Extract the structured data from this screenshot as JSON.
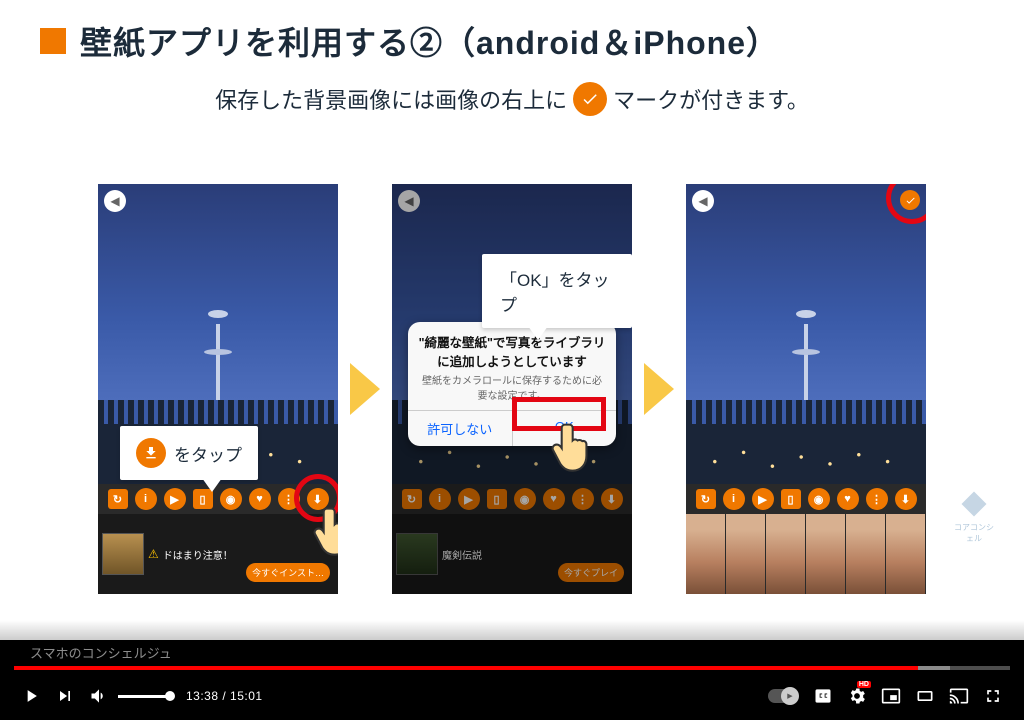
{
  "slide": {
    "title": "壁紙アプリを利用する②（android＆iPhone）",
    "subtitle_before": "保存した背景画像には画像の右上に",
    "subtitle_after": "マークが付きます。",
    "callout1": "をタップ",
    "callout2": "「OK」をタップ",
    "banner1_text": "ドはまり注意！",
    "banner1_cta": "今すぐインスト…",
    "banner2_text": "魔剣伝説",
    "banner2_cta": "今すぐプレイ"
  },
  "dialog": {
    "title": "\"綺麗な壁紙\"で写真をライブラリに追加しようとしています",
    "subtitle": "壁紙をカメラロールに保存するために必要な設定です。",
    "deny": "許可しない",
    "ok": "OK"
  },
  "player": {
    "current_time": "13:38",
    "duration": "15:01",
    "progress_percent": 90.8,
    "channel": "スマホのコンシェルジュ",
    "hd": "HD"
  },
  "watermark": "コアコンシェル"
}
